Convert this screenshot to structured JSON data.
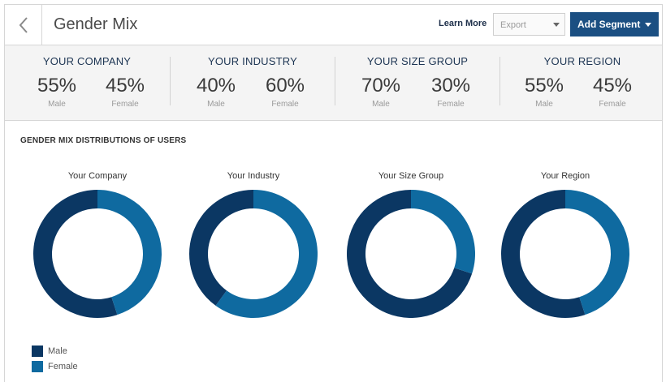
{
  "header": {
    "title": "Gender Mix",
    "learn_more": "Learn More",
    "export_value": "Export",
    "add_segment": "Add Segment"
  },
  "summary": [
    {
      "title": "YOUR COMPANY",
      "male_value": "55%",
      "male_label": "Male",
      "female_value": "45%",
      "female_label": "Female"
    },
    {
      "title": "YOUR INDUSTRY",
      "male_value": "40%",
      "male_label": "Male",
      "female_value": "60%",
      "female_label": "Female"
    },
    {
      "title": "YOUR SIZE GROUP",
      "male_value": "70%",
      "male_label": "Male",
      "female_value": "30%",
      "female_label": "Female"
    },
    {
      "title": "YOUR REGION",
      "male_value": "55%",
      "male_label": "Male",
      "female_value": "45%",
      "female_label": "Female"
    }
  ],
  "section_title": "GENDER MIX DISTRIBUTIONS OF USERS",
  "colors": {
    "male": "#0b3763",
    "female": "#0f6aa0",
    "brand": "#1b4f82"
  },
  "icons": {
    "back": "chevron-left-icon"
  },
  "chart_data": {
    "type": "pie",
    "donut": true,
    "categories": [
      "Male",
      "Female"
    ],
    "legend": [
      "Male",
      "Female"
    ],
    "legend_position": "bottom-left",
    "charts": [
      {
        "title": "Your Company",
        "values": [
          55,
          45
        ]
      },
      {
        "title": "Your Industry",
        "values": [
          40,
          60
        ]
      },
      {
        "title": "Your Size Group",
        "values": [
          70,
          30
        ]
      },
      {
        "title": "Your Region",
        "values": [
          55,
          45
        ]
      }
    ]
  }
}
